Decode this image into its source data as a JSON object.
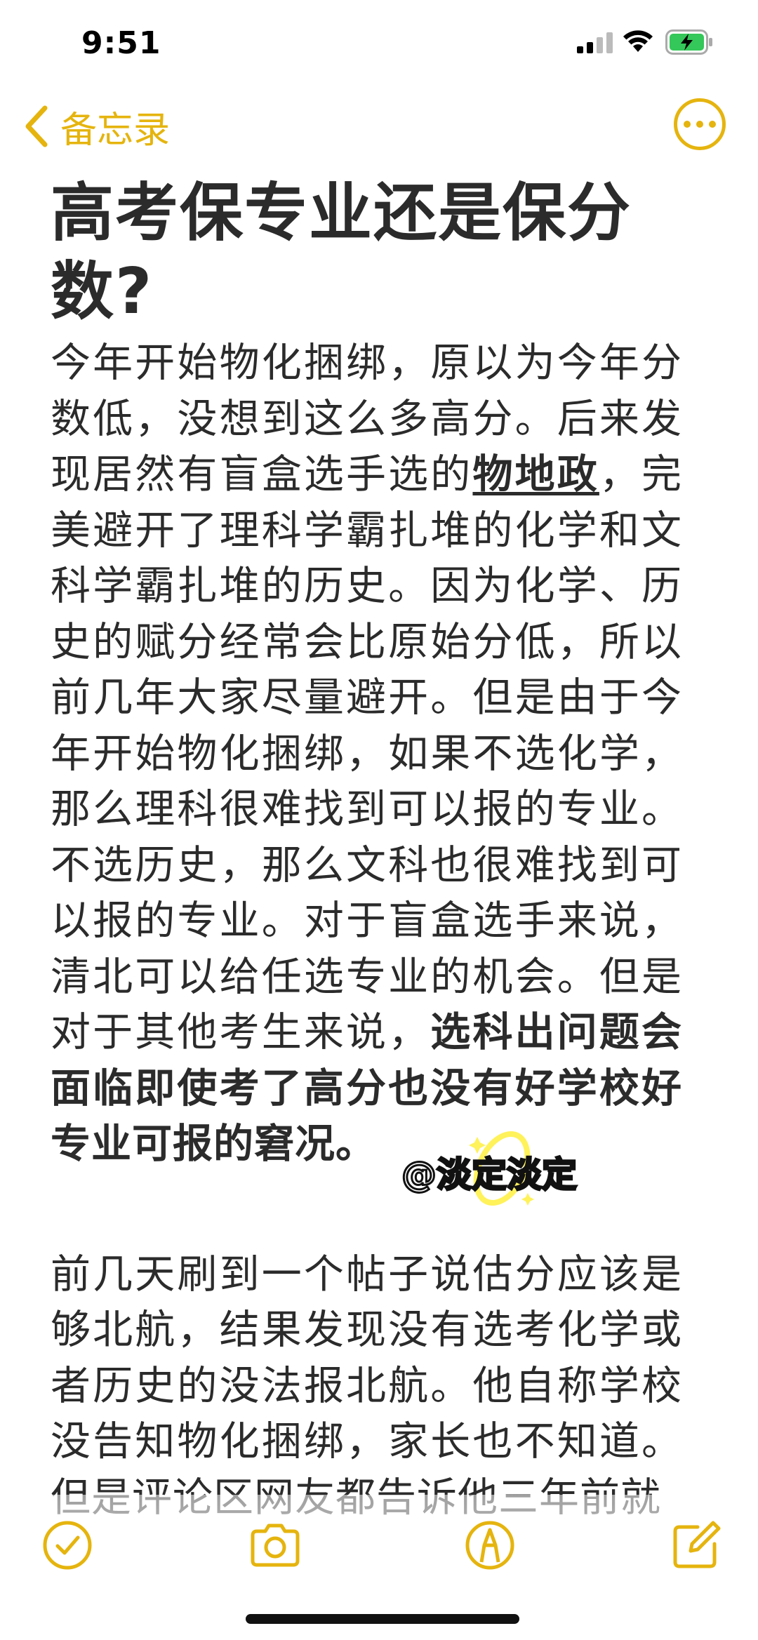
{
  "status_bar": {
    "time": "9:51"
  },
  "nav": {
    "back_label": "备忘录"
  },
  "note": {
    "title": "高考保专业还是保分数?",
    "p1_a": "今年开始物化捆绑，原以为今年分数低，没想到这么多高分。后来发现居然有盲盒选手选的",
    "p1_underline": "物地政",
    "p1_b": "，完美避开了理科学霸扎堆的化学和文科学霸扎堆的历史。因为化学、历史的赋分经常会比原始分低，所以前几年大家尽量避开。但是由于今年开始物化捆绑，如果不选化学，那么理科很难找到可以报的专业。不选历史，那么文科也很难找到可以报的专业。对于盲盒选手来说，清北可以给任选专业的机会。但是对于其他考生来说，",
    "p1_bold": "选科出问题会面临即使考了高分也没有好学校好专业可报的窘况。",
    "p2": "前几天刷到一个帖子说估分应该是够北航，结果发现没有选考化学或者历史的没法报北航。他自称学校没告知物化捆绑，家长也不知道。但是评论区网友都告诉他三年前就"
  },
  "watermark": {
    "text": "@淡定淡定"
  },
  "toolbar": {
    "icons": [
      "checklist-icon",
      "camera-icon",
      "markup-icon",
      "compose-icon"
    ]
  },
  "colors": {
    "accent": "#E5B40E",
    "text": "#2b2b2b"
  }
}
